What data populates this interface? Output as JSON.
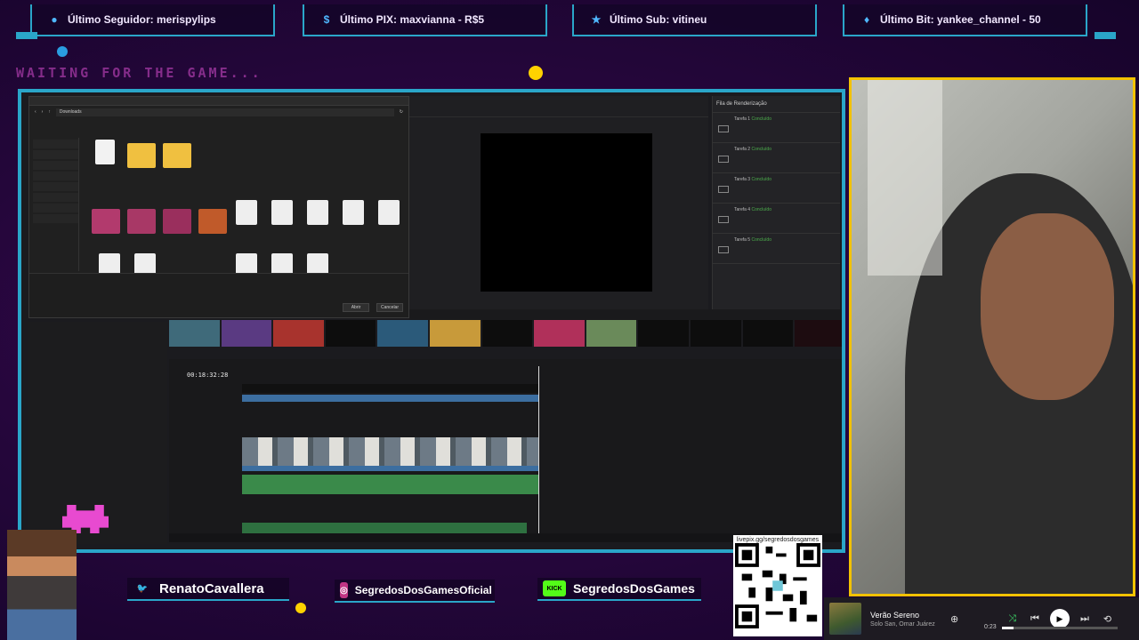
{
  "alerts": [
    {
      "icon": "user-icon",
      "label": "Último Seguidor: merispylips"
    },
    {
      "icon": "dollar-icon",
      "label": "Último PIX: maxvianna - R$5"
    },
    {
      "icon": "star-icon",
      "label": "Último Sub: vitineu"
    },
    {
      "icon": "diamond-icon",
      "label": "Último Bit: yankee_channel - 50"
    }
  ],
  "waiting": "WAITING FOR THE GAME...",
  "editor": {
    "folder_path": "Downloads",
    "timecode": "00:18:32:28",
    "render_queue_title": "Fila de Renderização",
    "render_jobs": [
      {
        "name": "Tarefa 1",
        "status": "Concluído"
      },
      {
        "name": "Tarefa 2",
        "status": "Concluído"
      },
      {
        "name": "Tarefa 3",
        "status": "Concluído"
      },
      {
        "name": "Tarefa 4",
        "status": "Concluído"
      },
      {
        "name": "Tarefa 5",
        "status": "Concluído"
      }
    ],
    "dialog_buttons": {
      "open": "Abrir",
      "cancel": "Cancelar"
    }
  },
  "social": {
    "twitter": "RenatoCavallera",
    "instagram": "SegredosDosGamesOficial",
    "kick_badge": "KICK",
    "kick": "SegredosDosGames",
    "qr_url": "livepix.gg/segredosdosgames"
  },
  "player": {
    "title": "Verão Sereno",
    "artist": "Solo San, Omar Juárez",
    "time": "0:23",
    "progress": 0.1
  },
  "colors": {
    "frame": "#2aa6c9",
    "cam_border": "#f3c200",
    "accent": "#d84dd0"
  }
}
